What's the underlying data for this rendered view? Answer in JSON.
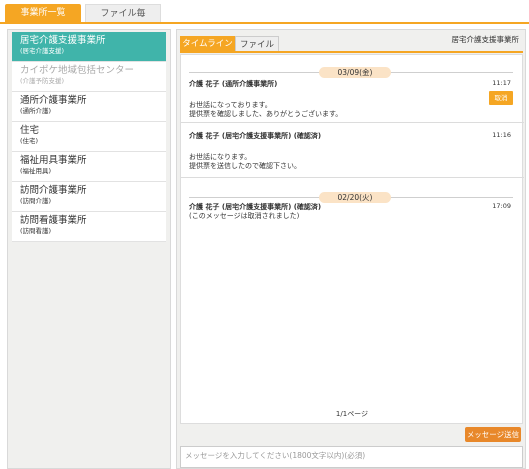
{
  "top_tabs": {
    "active": "事業所一覧",
    "inactive": "ファイル毎"
  },
  "sidebar": {
    "items": [
      {
        "name": "居宅介護支援事業所",
        "sub": "(居宅介護支援)"
      },
      {
        "name": "カイポケ地域包括センター",
        "sub": "(介護予防支援)"
      },
      {
        "name": "通所介護事業所",
        "sub": "(通所介護)"
      },
      {
        "name": "住宅",
        "sub": "(住宅)"
      },
      {
        "name": "福祉用具事業所",
        "sub": "(福祉用具)"
      },
      {
        "name": "訪問介護事業所",
        "sub": "(訪問介護)"
      },
      {
        "name": "訪問看護事業所",
        "sub": "(訪問看護)"
      }
    ]
  },
  "panel": {
    "tabs": {
      "timeline": "タイムライン",
      "file": "ファイル"
    },
    "facility_name": "居宅介護支援事業所"
  },
  "timeline": {
    "date1": "03/09(金)",
    "msg1": {
      "from": "介護 花子 (通所介護事業所)",
      "time": "11:17",
      "body": "お世話になっております。\n提供票を確認しました、ありがとうございます。",
      "cancel": "取消"
    },
    "msg2": {
      "from": "介護 花子 (居宅介護支援事業所) (確認済)",
      "time": "11:16",
      "body": "お世話になります。\n提供票を送信したので確認下さい。"
    },
    "date2": "02/20(火)",
    "msg3": {
      "from": "介護 花子 (居宅介護支援事業所) (確認済)",
      "time": "17:09",
      "body": "(このメッセージは取消されました)"
    }
  },
  "pager": "1/1ページ",
  "compose": {
    "send_label": "メッセージ送信",
    "placeholder": "メッセージを入力してください(1800文字以内)(必須)"
  }
}
